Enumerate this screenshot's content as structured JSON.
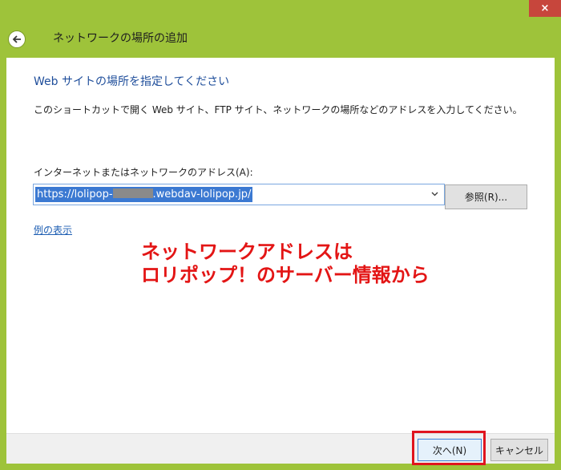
{
  "window": {
    "title": "ネットワークの場所の追加",
    "close_symbol": "×"
  },
  "dialog": {
    "heading": "Web サイトの場所を指定してください",
    "description": "このショートカットで開く Web サイト、FTP サイト、ネットワークの場所などのアドレスを入力してください。",
    "address_label": "インターネットまたはネットワークのアドレス(A):",
    "address_value_prefix": "https://lolipop-",
    "address_value_suffix": ".webdav-lolipop.jp/",
    "browse_button": "参照(R)...",
    "example_link": "例の表示"
  },
  "annotation": {
    "line1": "ネットワークアドレスは",
    "line2": "ロリポップ！のサーバー情報から"
  },
  "footer": {
    "next_button": "次へ(N)",
    "cancel_button": "キャンセル"
  },
  "colors": {
    "window_frame": "#9ec33a",
    "heading": "#1f4e9b",
    "annotation": "#e31515",
    "highlight_box": "#e0141e",
    "selection": "#3b79d2"
  },
  "icons": {
    "back": "back-arrow-icon",
    "close": "close-icon",
    "dropdown": "chevron-down-icon"
  }
}
